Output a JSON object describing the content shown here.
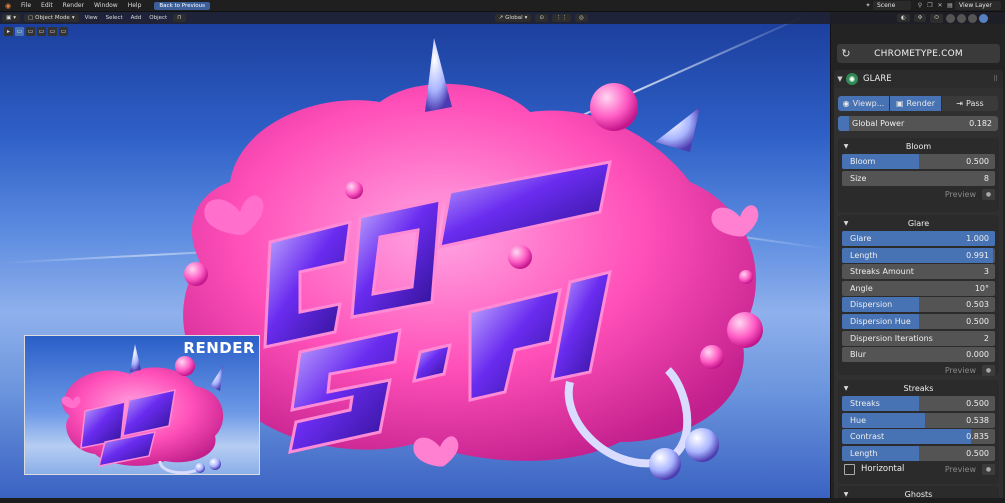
{
  "menubar": {
    "items": [
      "File",
      "Edit",
      "Render",
      "Window",
      "Help"
    ],
    "back_button": "Back to Previous",
    "scene": "Scene",
    "view_layer": "View Layer"
  },
  "viewport_header": {
    "mode": "Object Mode",
    "menus": [
      "View",
      "Select",
      "Add",
      "Object"
    ],
    "orientation": "Global"
  },
  "preview": {
    "label": "RENDER"
  },
  "panel": {
    "site_label": "CHROMETYPE.COM",
    "node_title": "GLARE",
    "tabs": {
      "viewport": "Viewp...",
      "render": "Render",
      "pass": "Pass"
    },
    "global_power": {
      "label": "Global Power",
      "value": "0.182",
      "fraction": 0.07
    },
    "bloom": {
      "title": "Bloom",
      "props": [
        {
          "label": "Bloom",
          "value": "0.500",
          "fraction": 0.5
        },
        {
          "label": "Size",
          "value": "8",
          "fraction": 0.0
        }
      ],
      "preview": "Preview"
    },
    "glare": {
      "title": "Glare",
      "props": [
        {
          "label": "Glare",
          "value": "1.000",
          "fraction": 1.0
        },
        {
          "label": "Length",
          "value": "0.991",
          "fraction": 0.99
        },
        {
          "label": "Streaks Amount",
          "value": "3",
          "fraction": 0.0
        },
        {
          "label": "Angle",
          "value": "10°",
          "fraction": 0.0
        },
        {
          "label": "Dispersion",
          "value": "0.503",
          "fraction": 0.5
        },
        {
          "label": "Dispersion Hue",
          "value": "0.500",
          "fraction": 0.5
        },
        {
          "label": "Dispersion Iterations",
          "value": "2",
          "fraction": 0.0
        },
        {
          "label": "Blur",
          "value": "0.000",
          "fraction": 0.0
        }
      ],
      "preview": "Preview"
    },
    "streaks": {
      "title": "Streaks",
      "props": [
        {
          "label": "Streaks",
          "value": "0.500",
          "fraction": 0.5
        },
        {
          "label": "Hue",
          "value": "0.538",
          "fraction": 0.54
        },
        {
          "label": "Contrast",
          "value": "0.835",
          "fraction": 0.84
        },
        {
          "label": "Length",
          "value": "0.500",
          "fraction": 0.5
        }
      ],
      "horizontal_label": "Horizontal",
      "preview": "Preview"
    },
    "ghosts": {
      "title": "Ghosts"
    }
  },
  "colors": {
    "accent": "#4772b3",
    "panel_bg": "#303030",
    "field_bg": "#545454",
    "pink": "#ff4fb8",
    "violet": "#7a3cf0"
  },
  "icons": {
    "refresh": "refresh-icon",
    "node": "glare-node-icon",
    "eye": "eye-icon",
    "camera": "camera-icon",
    "pass": "pass-arrow-icon"
  }
}
